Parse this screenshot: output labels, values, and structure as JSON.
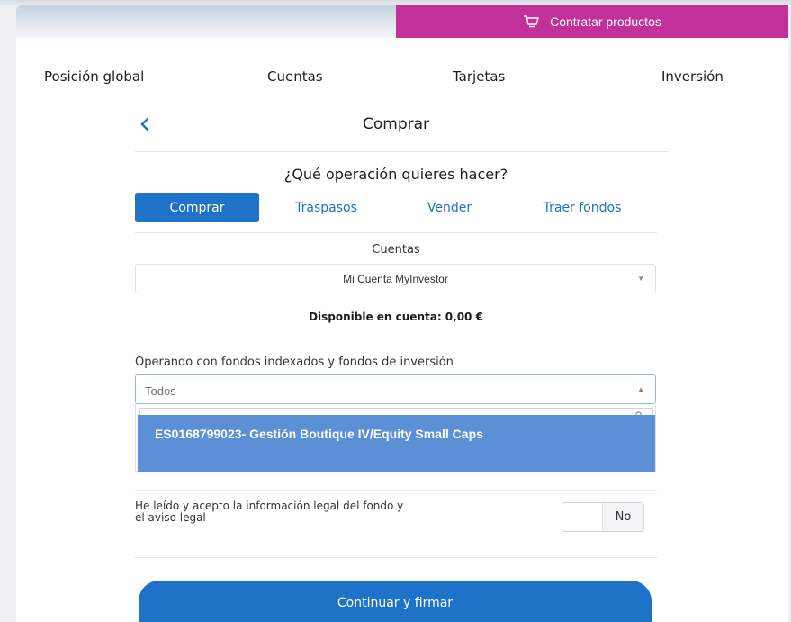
{
  "topbar": {
    "contract_label": "Contratar productos"
  },
  "nav": {
    "items": [
      "Posición global",
      "Cuentas",
      "Tarjetas",
      "Inversión"
    ]
  },
  "header": {
    "title": "Comprar"
  },
  "operation": {
    "question": "¿Qué operación quieres hacer?",
    "tabs": [
      "Comprar",
      "Traspasos",
      "Vender",
      "Traer fondos"
    ],
    "active_tab": "Comprar"
  },
  "account": {
    "label": "Cuentas",
    "selected": "Mi Cuenta MyInvestor",
    "available": "Disponible en cuenta: 0,00 €"
  },
  "fund": {
    "label": "Operando con fondos indexados y fondos de inversión",
    "selected": "Todos",
    "highlighted_option": "ES0168799023- Gestión Boutique IV/Equity Small Caps"
  },
  "legal": {
    "text": "He leído y acepto la información legal del fondo y el aviso legal",
    "toggle_value": "No"
  },
  "footer": {
    "continue_label": "Continuar y firmar"
  },
  "colors": {
    "brand_blue": "#1e73c8",
    "magenta": "#c4309a",
    "option_blue": "#5b8fd6"
  }
}
